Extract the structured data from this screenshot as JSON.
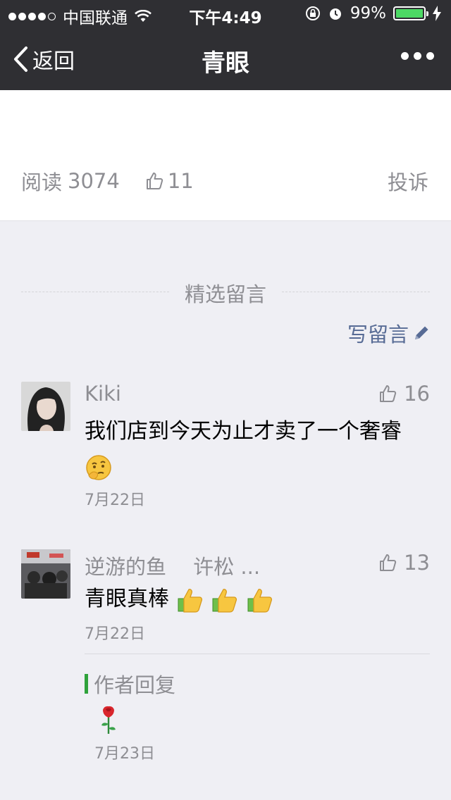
{
  "status_bar": {
    "carrier": "中国联通",
    "time": "下午4:49",
    "battery": "99%",
    "battery_level": 0.99
  },
  "nav": {
    "back_label": "返回",
    "title": "青眼"
  },
  "article": {
    "read_label": "阅读",
    "read_count": "3074",
    "likes": "11",
    "report_label": "投诉"
  },
  "comments_section": {
    "title": "精选留言",
    "write_label": "写留言"
  },
  "comments": [
    {
      "name": "Kiki",
      "likes": "16",
      "text": "我们店到今天为止才卖了一个奢睿",
      "date": "7月22日"
    },
    {
      "name": "逆游的鱼　 许松 ...",
      "likes": "13",
      "text": "青眼真棒",
      "date": "7月22日",
      "reply": {
        "label": "作者回复",
        "date": "7月23日"
      }
    }
  ],
  "colors": {
    "nav_bg": "#2f2f33",
    "page_bg": "#efeff4",
    "link": "#576b95",
    "muted": "#8e8e93",
    "reply_bar": "#2fa23b",
    "battery": "#4cd964"
  },
  "icons": [
    "wifi-icon",
    "lock-rotation-icon",
    "alarm-icon",
    "charging-icon",
    "back-chevron-icon",
    "more-icon",
    "thumb-up-icon",
    "pencil-icon",
    "thinking-emoji",
    "thumbs-up-emoji",
    "rose-emoji"
  ]
}
